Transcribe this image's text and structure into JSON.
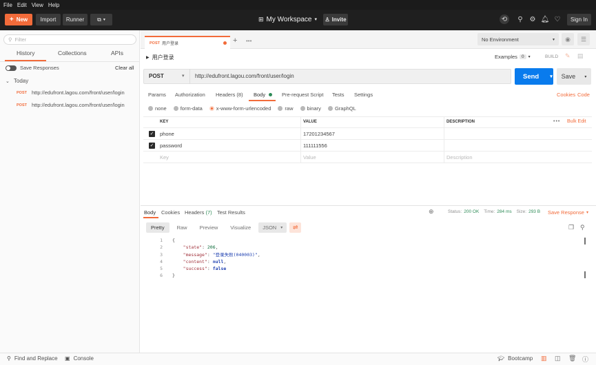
{
  "menu": [
    "File",
    "Edit",
    "View",
    "Help"
  ],
  "header": {
    "new_label": "New",
    "import_label": "Import",
    "runner_label": "Runner",
    "workspace_label": "My Workspace",
    "invite_label": "Invite",
    "signin_label": "Sign In"
  },
  "sidebar": {
    "filter_placeholder": "Filter",
    "tabs": [
      "History",
      "Collections",
      "APIs"
    ],
    "save_responses": "Save Responses",
    "clear_all": "Clear all",
    "group_label": "Today",
    "items": [
      {
        "method": "POST",
        "url": "http://edufront.lagou.com/front/user/login"
      },
      {
        "method": "POST",
        "url": "http://edufront.lagou.com/front/user/login"
      }
    ]
  },
  "tab": {
    "method": "POST",
    "name": "用户登录",
    "more": "•••"
  },
  "environment": {
    "selected": "No Environment"
  },
  "request": {
    "name": "用户登录",
    "examples_label": "Examples",
    "examples_count": "0",
    "build_label": "BUILD",
    "method": "POST",
    "url": "http://edufront.lagou.com/front/user/login",
    "send_label": "Send",
    "save_label": "Save",
    "subtabs": {
      "params": "Params",
      "authorization": "Authorization",
      "headers": "Headers (8)",
      "body": "Body",
      "prerequest": "Pre-request Script",
      "tests": "Tests",
      "settings": "Settings"
    },
    "cookies_label": "Cookies",
    "code_label": "Code",
    "body_types": [
      "none",
      "form-data",
      "x-www-form-urlencoded",
      "raw",
      "binary",
      "GraphQL"
    ],
    "body_type_selected": "x-www-form-urlencoded",
    "table": {
      "columns": [
        "KEY",
        "VALUE",
        "DESCRIPTION"
      ],
      "more": "•••",
      "bulk_edit": "Bulk Edit",
      "rows": [
        {
          "key": "phone",
          "value": "17201234567"
        },
        {
          "key": "password",
          "value": "111111556"
        }
      ],
      "placeholder": {
        "key": "Key",
        "value": "Value",
        "description": "Description"
      }
    }
  },
  "response": {
    "tabs": {
      "body": "Body",
      "cookies": "Cookies",
      "headers": "Headers",
      "headers_count": "(7)",
      "tests": "Test Results"
    },
    "status_label": "Status:",
    "status_value": "200 OK",
    "time_label": "Time:",
    "time_value": "284 ms",
    "size_label": "Size:",
    "size_value": "293 B",
    "save_response": "Save Response",
    "formats": [
      "Pretty",
      "Raw",
      "Preview",
      "Visualize"
    ],
    "format_selected": "JSON",
    "code": {
      "state_key": "\"state\"",
      "state_val": "206",
      "message_key": "\"message\"",
      "message_val": "\"登录失败(040003)\"",
      "content_key": "\"content\"",
      "content_val": "null",
      "success_key": "\"success\"",
      "success_val": "false"
    }
  },
  "statusbar": {
    "find_replace": "Find and Replace",
    "console": "Console",
    "bootcamp": "Bootcamp"
  },
  "colors": {
    "accent": "#f26b3a",
    "send": "#097bed",
    "ok": "#2e8b57"
  }
}
